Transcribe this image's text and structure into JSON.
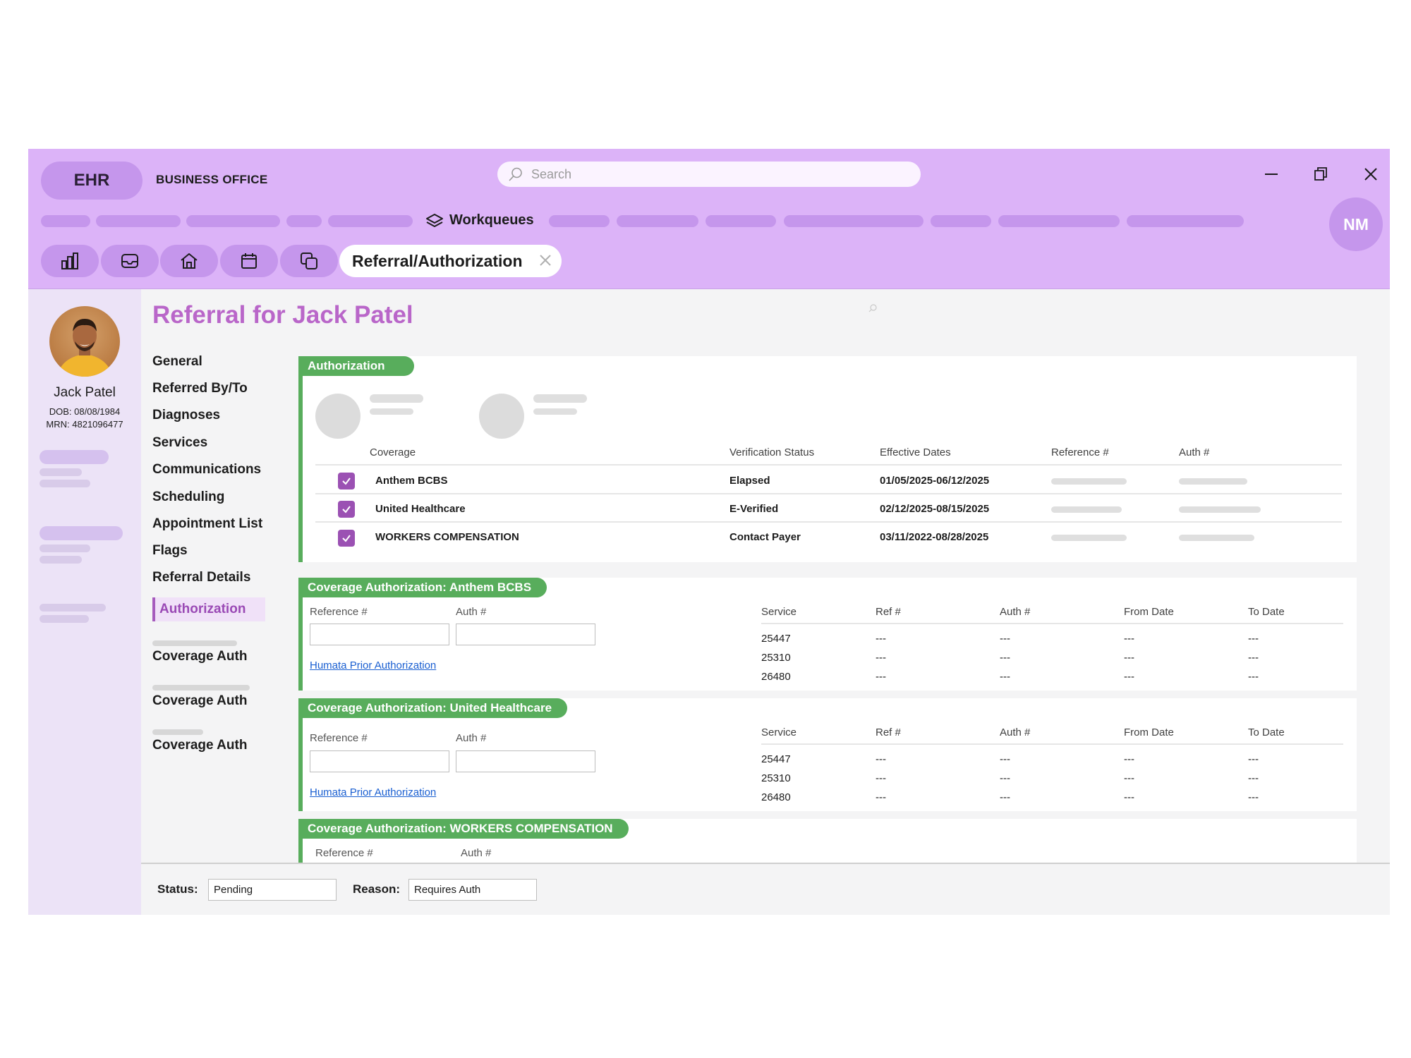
{
  "app": {
    "badge": "EHR",
    "section_title": "BUSINESS OFFICE",
    "search_placeholder": "Search",
    "user_initials": "NM",
    "workqueues_label": "Workqueues",
    "active_tab": "Referral/Authorization",
    "tab_icons": [
      "chart-icon",
      "inbox-icon",
      "home-icon",
      "calendar-icon",
      "copy-icon"
    ]
  },
  "patient": {
    "name": "Jack Patel",
    "dob": "DOB: 08/08/1984",
    "mrn": "MRN: 4821096477"
  },
  "page_title": "Referral for Jack Patel",
  "nav": {
    "items": [
      "General",
      "Referred By/To",
      "Diagnoses",
      "Services",
      "Communications",
      "Scheduling",
      "Appointment List",
      "Flags",
      "Referral Details"
    ],
    "active": "Authorization",
    "sub_items": [
      "Coverage Auth",
      "Coverage Auth",
      "Coverage Auth"
    ]
  },
  "authorization": {
    "tag": "Authorization",
    "headers": {
      "coverage": "Coverage",
      "verification": "Verification Status",
      "dates": "Effective Dates",
      "reference": "Reference #",
      "auth": "Auth #"
    },
    "rows": [
      {
        "coverage": "Anthem BCBS",
        "status": "Elapsed",
        "dates": "01/05/2025-06/12/2025",
        "checked": true
      },
      {
        "coverage": "United Healthcare",
        "status": "E-Verified",
        "dates": "02/12/2025-08/15/2025",
        "checked": true
      },
      {
        "coverage": "WORKERS COMPENSATION",
        "status": "Contact Payer",
        "dates": "03/11/2022-08/28/2025",
        "checked": true
      }
    ]
  },
  "coverage_auths": [
    {
      "tag": "Coverage Authorization: Anthem BCBS",
      "ref_label": "Reference #",
      "auth_label": "Auth #",
      "ref_value": "",
      "auth_value": "",
      "link": "Humata Prior Authorization",
      "headers": {
        "service": "Service",
        "ref": "Ref #",
        "auth": "Auth #",
        "from": "From Date",
        "to": "To Date"
      },
      "rows": [
        {
          "service": "25447",
          "ref": "---",
          "auth": "---",
          "from": "---",
          "to": "---"
        },
        {
          "service": "25310",
          "ref": "---",
          "auth": "---",
          "from": "---",
          "to": "---"
        },
        {
          "service": "26480",
          "ref": "---",
          "auth": "---",
          "from": "---",
          "to": "---"
        }
      ]
    },
    {
      "tag": "Coverage Authorization: United Healthcare",
      "ref_label": "Reference #",
      "auth_label": "Auth #",
      "ref_value": "",
      "auth_value": "",
      "link": "Humata Prior Authorization",
      "headers": {
        "service": "Service",
        "ref": "Ref #",
        "auth": "Auth #",
        "from": "From Date",
        "to": "To Date"
      },
      "rows": [
        {
          "service": "25447",
          "ref": "---",
          "auth": "---",
          "from": "---",
          "to": "---"
        },
        {
          "service": "25310",
          "ref": "---",
          "auth": "---",
          "from": "---",
          "to": "---"
        },
        {
          "service": "26480",
          "ref": "---",
          "auth": "---",
          "from": "---",
          "to": "---"
        }
      ]
    },
    {
      "tag": "Coverage Authorization: WORKERS COMPENSATION",
      "ref_label": "Reference #",
      "auth_label": "Auth #"
    }
  ],
  "footer": {
    "status_label": "Status:",
    "status_value": "Pending",
    "reason_label": "Reason:",
    "reason_value": "Requires Auth"
  },
  "colors": {
    "header_bg": "#dcb3f8",
    "accent_purple": "#b966c9",
    "check_purple": "#9b51b3",
    "section_green": "#58ad5c",
    "link_blue": "#1a5fd1"
  }
}
